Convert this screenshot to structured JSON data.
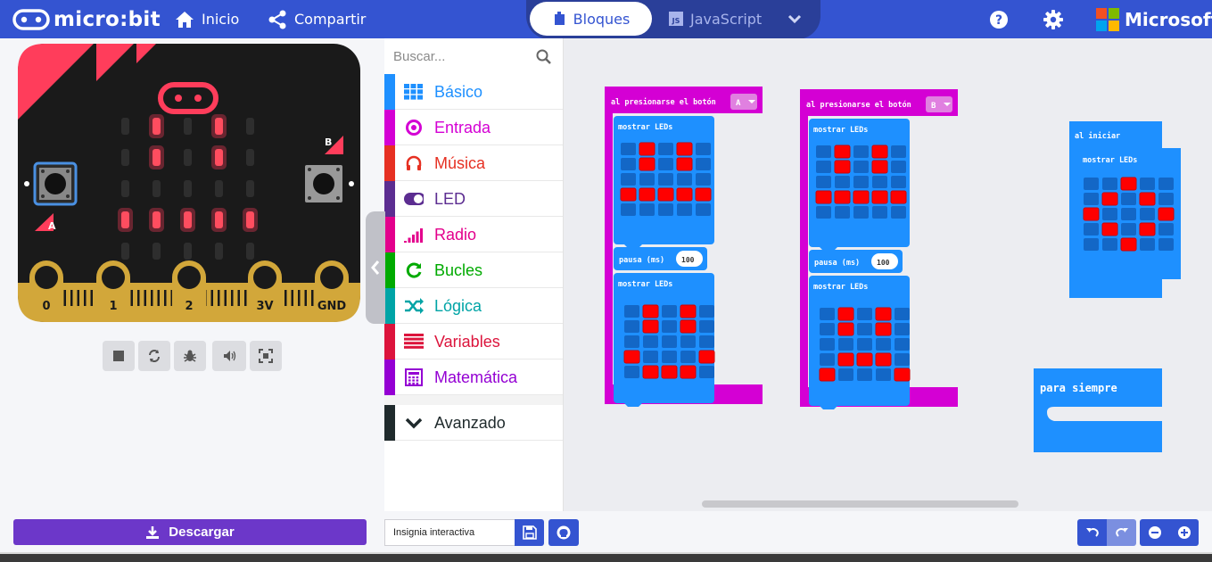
{
  "header": {
    "logo_text": "micro:bit",
    "home_label": "Inicio",
    "share_label": "Compartir",
    "tab_blocks_label": "Bloques",
    "tab_js_label": "JavaScript",
    "brand_label": "Microsoft"
  },
  "simulator": {
    "pins": [
      "0",
      "1",
      "2",
      "3V",
      "GND"
    ],
    "button_a_label": "A",
    "button_b_label": "B",
    "display": [
      [
        0,
        1,
        0,
        1,
        0
      ],
      [
        0,
        1,
        0,
        1,
        0
      ],
      [
        0,
        0,
        0,
        0,
        0
      ],
      [
        1,
        1,
        1,
        1,
        1
      ],
      [
        0,
        0,
        0,
        0,
        0
      ]
    ],
    "controls": [
      "stop-icon",
      "restart-icon",
      "debug-icon",
      "sound-icon",
      "fullscreen-icon"
    ]
  },
  "toolbox": {
    "search_placeholder": "Buscar...",
    "categories": [
      {
        "label": "Básico",
        "color": "#1e90ff",
        "icon": "grid-icon"
      },
      {
        "label": "Entrada",
        "color": "#d400d4",
        "icon": "target-icon"
      },
      {
        "label": "Música",
        "color": "#e63022",
        "icon": "headphones-icon"
      },
      {
        "label": "LED",
        "color": "#5c2d91",
        "icon": "toggle-icon"
      },
      {
        "label": "Radio",
        "color": "#e3008c",
        "icon": "signal-icon"
      },
      {
        "label": "Bucles",
        "color": "#00aa00",
        "icon": "refresh-icon"
      },
      {
        "label": "Lógica",
        "color": "#00a4a6",
        "icon": "shuffle-icon"
      },
      {
        "label": "Variables",
        "color": "#dc143c",
        "icon": "lines-icon"
      },
      {
        "label": "Matemática",
        "color": "#9400d3",
        "icon": "calculator-icon"
      },
      {
        "label": "Avanzado",
        "color": "#1f2a2c",
        "icon": "chevron-down-icon"
      }
    ]
  },
  "workspace": {
    "blocks": [
      {
        "hat_label": "al presionarse el botón",
        "button_value": "A",
        "show_label_1": "mostrar LEDs",
        "pattern_1": [
          [
            0,
            1,
            0,
            1,
            0
          ],
          [
            0,
            1,
            0,
            1,
            0
          ],
          [
            0,
            0,
            0,
            0,
            0
          ],
          [
            1,
            1,
            1,
            1,
            1
          ],
          [
            0,
            0,
            0,
            0,
            0
          ]
        ],
        "pause_label": "pausa (ms)",
        "pause_value": "100",
        "show_label_2": "mostrar LEDs",
        "pattern_2": [
          [
            0,
            1,
            0,
            1,
            0
          ],
          [
            0,
            1,
            0,
            1,
            0
          ],
          [
            0,
            0,
            0,
            0,
            0
          ],
          [
            1,
            0,
            0,
            0,
            1
          ],
          [
            0,
            1,
            1,
            1,
            0
          ]
        ]
      },
      {
        "hat_label": "al presionarse el botón",
        "button_value": "B",
        "show_label_1": "mostrar LEDs",
        "pattern_1": [
          [
            0,
            1,
            0,
            1,
            0
          ],
          [
            0,
            1,
            0,
            1,
            0
          ],
          [
            0,
            0,
            0,
            0,
            0
          ],
          [
            1,
            1,
            1,
            1,
            1
          ],
          [
            0,
            0,
            0,
            0,
            0
          ]
        ],
        "pause_label": "pausa (ms)",
        "pause_value": "100",
        "show_label_2": "mostrar LEDs",
        "pattern_2": [
          [
            0,
            1,
            0,
            1,
            0
          ],
          [
            0,
            1,
            0,
            1,
            0
          ],
          [
            0,
            0,
            0,
            0,
            0
          ],
          [
            0,
            1,
            1,
            1,
            0
          ],
          [
            1,
            0,
            0,
            0,
            1
          ]
        ]
      }
    ],
    "on_start": {
      "label": "al iniciar",
      "show_label": "mostrar LEDs",
      "pattern": [
        [
          0,
          0,
          1,
          0,
          0
        ],
        [
          0,
          1,
          0,
          1,
          0
        ],
        [
          1,
          0,
          0,
          0,
          1
        ],
        [
          0,
          1,
          0,
          1,
          0
        ],
        [
          0,
          0,
          1,
          0,
          0
        ]
      ]
    },
    "forever_label": "para siempre"
  },
  "footer": {
    "download_label": "Descargar",
    "project_name": "Insignia interactiva"
  },
  "colors": {
    "header_blue": "#3454d1",
    "block_magenta": "#d400d4",
    "block_blue": "#1e90ff",
    "led_red": "#ff0000",
    "board_red": "#ff3d5b"
  }
}
